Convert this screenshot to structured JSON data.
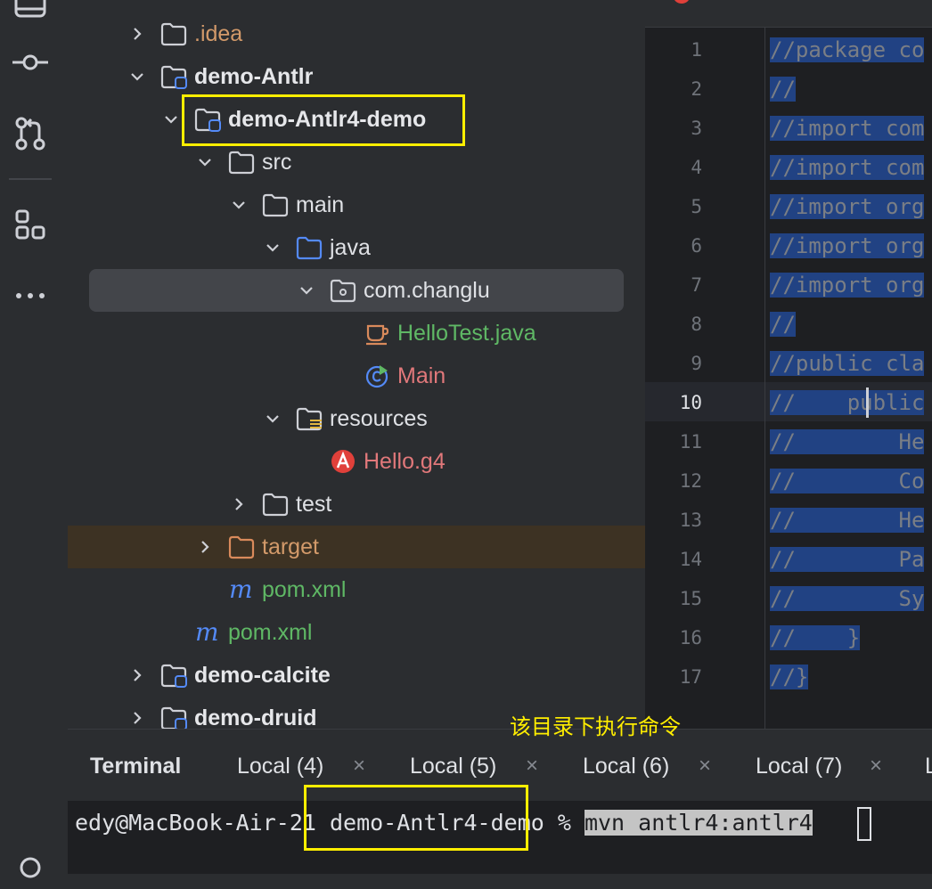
{
  "tree": {
    "items": [
      {
        "label": ".idea"
      },
      {
        "label": "demo-Antlr"
      },
      {
        "label": "demo-Antlr4-demo"
      },
      {
        "label": "src"
      },
      {
        "label": "main"
      },
      {
        "label": "java"
      },
      {
        "label": "com.changlu"
      },
      {
        "label": "HelloTest.java"
      },
      {
        "label": "Main"
      },
      {
        "label": "resources"
      },
      {
        "label": "Hello.g4"
      },
      {
        "label": "test"
      },
      {
        "label": "target"
      },
      {
        "label": "pom.xml"
      },
      {
        "label": "pom.xml"
      },
      {
        "label": "demo-calcite"
      },
      {
        "label": "demo-druid"
      }
    ]
  },
  "editor": {
    "current_line": "10",
    "line_numbers": [
      "1",
      "2",
      "3",
      "4",
      "5",
      "6",
      "7",
      "8",
      "9",
      "10",
      "11",
      "12",
      "13",
      "14",
      "15",
      "16",
      "17"
    ],
    "lines": [
      "//package co",
      "//",
      "//import com",
      "//import com",
      "//import org",
      "//import org",
      "//import org",
      "//",
      "//public cla",
      "//    public",
      "//        He",
      "//        Co",
      "//        He",
      "//        Pa",
      "//        Sy",
      "//    }",
      "//}"
    ]
  },
  "annotation": "该目录下执行命令",
  "terminal": {
    "title": "Terminal",
    "tabs": [
      {
        "label": "Local (4)"
      },
      {
        "label": "Local (5)"
      },
      {
        "label": "Local (6)"
      },
      {
        "label": "Local (7)"
      },
      {
        "label": "L"
      }
    ],
    "close_glyph": "×",
    "prompt": "edy@MacBook-Air-21 demo-Antlr4-demo % ",
    "command": "mvn antlr4:antlr4"
  },
  "colors": {
    "highlight_box": "#ffee00",
    "selection": "#214283",
    "green_file": "#5fb865",
    "excluded_folder": "#d39a6a"
  }
}
